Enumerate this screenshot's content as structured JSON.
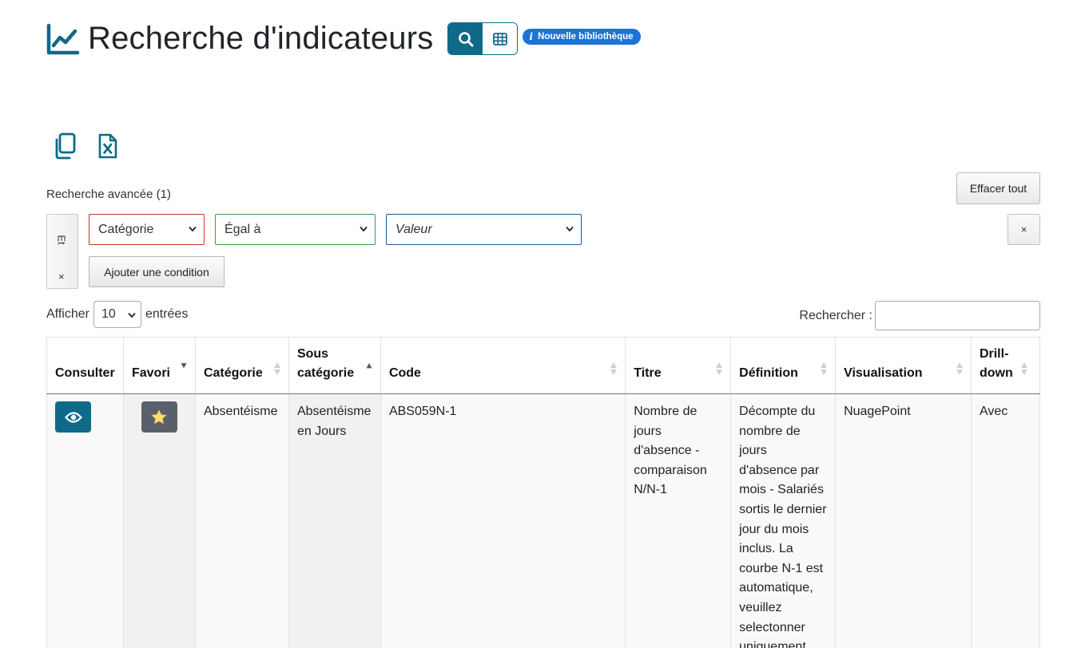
{
  "header": {
    "title": "Recherche d'indicateurs",
    "badge_label": "Nouvelle bibliothèque",
    "badge_icon": "i"
  },
  "advanced_search": {
    "title": "Recherche avancée (1)",
    "clear_all_label": "Effacer tout",
    "logic_label": "Et",
    "logic_remove": "×",
    "condition": {
      "field": "Catégorie",
      "operator": "Égal à",
      "value_placeholder": "Valeur"
    },
    "remove_condition_label": "×",
    "add_condition_label": "Ajouter une condition"
  },
  "table_controls": {
    "show_label": "Afficher",
    "page_length": "10",
    "entries_label": "entrées",
    "search_label": "Rechercher :",
    "search_value": ""
  },
  "table": {
    "columns": [
      "Consulter",
      "Favori",
      "Catégorie",
      "Sous catégorie",
      "Code",
      "Titre",
      "Définition",
      "Visualisation",
      "Drill-down"
    ],
    "rows": [
      {
        "categorie": "Absentéisme",
        "sous_categorie": "Absentéisme en Jours",
        "code": "ABS059N-1",
        "titre": "Nombre de jours d'absence - comparaison N/N-1",
        "definition": "Décompte du nombre de jours d'absence par mois - Salariés sortis le dernier jour du mois inclus. La courbe N-1 est automatique, veuillez selectonner uniquement",
        "visualisation": "NuagePoint",
        "drilldown": "Avec"
      }
    ]
  },
  "colors": {
    "primary": "#0e6a88",
    "badge": "#1a73d9",
    "favorite_button": "#5a606b",
    "star": "#f7de6e",
    "field_border_category": "#c0392b",
    "field_border_operator": "#3f9b48",
    "field_border_value": "#1f5a96"
  },
  "icons": {
    "title": "line-chart-icon",
    "search_view": "search-icon",
    "grid_view": "grid-icon",
    "copy": "copy-icon",
    "excel": "excel-file-icon",
    "consult": "eye-icon",
    "favorite": "star-icon"
  }
}
